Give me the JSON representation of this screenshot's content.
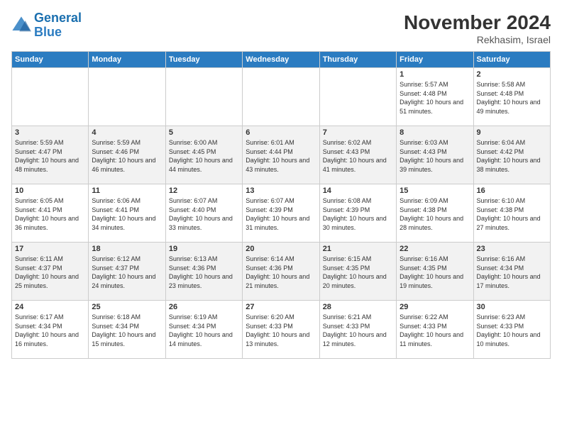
{
  "header": {
    "logo_general": "General",
    "logo_blue": "Blue",
    "title": "November 2024",
    "subtitle": "Rekhasim, Israel"
  },
  "days_of_week": [
    "Sunday",
    "Monday",
    "Tuesday",
    "Wednesday",
    "Thursday",
    "Friday",
    "Saturday"
  ],
  "weeks": [
    [
      {
        "num": "",
        "info": ""
      },
      {
        "num": "",
        "info": ""
      },
      {
        "num": "",
        "info": ""
      },
      {
        "num": "",
        "info": ""
      },
      {
        "num": "",
        "info": ""
      },
      {
        "num": "1",
        "info": "Sunrise: 5:57 AM\nSunset: 4:48 PM\nDaylight: 10 hours and 51 minutes."
      },
      {
        "num": "2",
        "info": "Sunrise: 5:58 AM\nSunset: 4:48 PM\nDaylight: 10 hours and 49 minutes."
      }
    ],
    [
      {
        "num": "3",
        "info": "Sunrise: 5:59 AM\nSunset: 4:47 PM\nDaylight: 10 hours and 48 minutes."
      },
      {
        "num": "4",
        "info": "Sunrise: 5:59 AM\nSunset: 4:46 PM\nDaylight: 10 hours and 46 minutes."
      },
      {
        "num": "5",
        "info": "Sunrise: 6:00 AM\nSunset: 4:45 PM\nDaylight: 10 hours and 44 minutes."
      },
      {
        "num": "6",
        "info": "Sunrise: 6:01 AM\nSunset: 4:44 PM\nDaylight: 10 hours and 43 minutes."
      },
      {
        "num": "7",
        "info": "Sunrise: 6:02 AM\nSunset: 4:43 PM\nDaylight: 10 hours and 41 minutes."
      },
      {
        "num": "8",
        "info": "Sunrise: 6:03 AM\nSunset: 4:43 PM\nDaylight: 10 hours and 39 minutes."
      },
      {
        "num": "9",
        "info": "Sunrise: 6:04 AM\nSunset: 4:42 PM\nDaylight: 10 hours and 38 minutes."
      }
    ],
    [
      {
        "num": "10",
        "info": "Sunrise: 6:05 AM\nSunset: 4:41 PM\nDaylight: 10 hours and 36 minutes."
      },
      {
        "num": "11",
        "info": "Sunrise: 6:06 AM\nSunset: 4:41 PM\nDaylight: 10 hours and 34 minutes."
      },
      {
        "num": "12",
        "info": "Sunrise: 6:07 AM\nSunset: 4:40 PM\nDaylight: 10 hours and 33 minutes."
      },
      {
        "num": "13",
        "info": "Sunrise: 6:07 AM\nSunset: 4:39 PM\nDaylight: 10 hours and 31 minutes."
      },
      {
        "num": "14",
        "info": "Sunrise: 6:08 AM\nSunset: 4:39 PM\nDaylight: 10 hours and 30 minutes."
      },
      {
        "num": "15",
        "info": "Sunrise: 6:09 AM\nSunset: 4:38 PM\nDaylight: 10 hours and 28 minutes."
      },
      {
        "num": "16",
        "info": "Sunrise: 6:10 AM\nSunset: 4:38 PM\nDaylight: 10 hours and 27 minutes."
      }
    ],
    [
      {
        "num": "17",
        "info": "Sunrise: 6:11 AM\nSunset: 4:37 PM\nDaylight: 10 hours and 25 minutes."
      },
      {
        "num": "18",
        "info": "Sunrise: 6:12 AM\nSunset: 4:37 PM\nDaylight: 10 hours and 24 minutes."
      },
      {
        "num": "19",
        "info": "Sunrise: 6:13 AM\nSunset: 4:36 PM\nDaylight: 10 hours and 23 minutes."
      },
      {
        "num": "20",
        "info": "Sunrise: 6:14 AM\nSunset: 4:36 PM\nDaylight: 10 hours and 21 minutes."
      },
      {
        "num": "21",
        "info": "Sunrise: 6:15 AM\nSunset: 4:35 PM\nDaylight: 10 hours and 20 minutes."
      },
      {
        "num": "22",
        "info": "Sunrise: 6:16 AM\nSunset: 4:35 PM\nDaylight: 10 hours and 19 minutes."
      },
      {
        "num": "23",
        "info": "Sunrise: 6:16 AM\nSunset: 4:34 PM\nDaylight: 10 hours and 17 minutes."
      }
    ],
    [
      {
        "num": "24",
        "info": "Sunrise: 6:17 AM\nSunset: 4:34 PM\nDaylight: 10 hours and 16 minutes."
      },
      {
        "num": "25",
        "info": "Sunrise: 6:18 AM\nSunset: 4:34 PM\nDaylight: 10 hours and 15 minutes."
      },
      {
        "num": "26",
        "info": "Sunrise: 6:19 AM\nSunset: 4:34 PM\nDaylight: 10 hours and 14 minutes."
      },
      {
        "num": "27",
        "info": "Sunrise: 6:20 AM\nSunset: 4:33 PM\nDaylight: 10 hours and 13 minutes."
      },
      {
        "num": "28",
        "info": "Sunrise: 6:21 AM\nSunset: 4:33 PM\nDaylight: 10 hours and 12 minutes."
      },
      {
        "num": "29",
        "info": "Sunrise: 6:22 AM\nSunset: 4:33 PM\nDaylight: 10 hours and 11 minutes."
      },
      {
        "num": "30",
        "info": "Sunrise: 6:23 AM\nSunset: 4:33 PM\nDaylight: 10 hours and 10 minutes."
      }
    ]
  ]
}
